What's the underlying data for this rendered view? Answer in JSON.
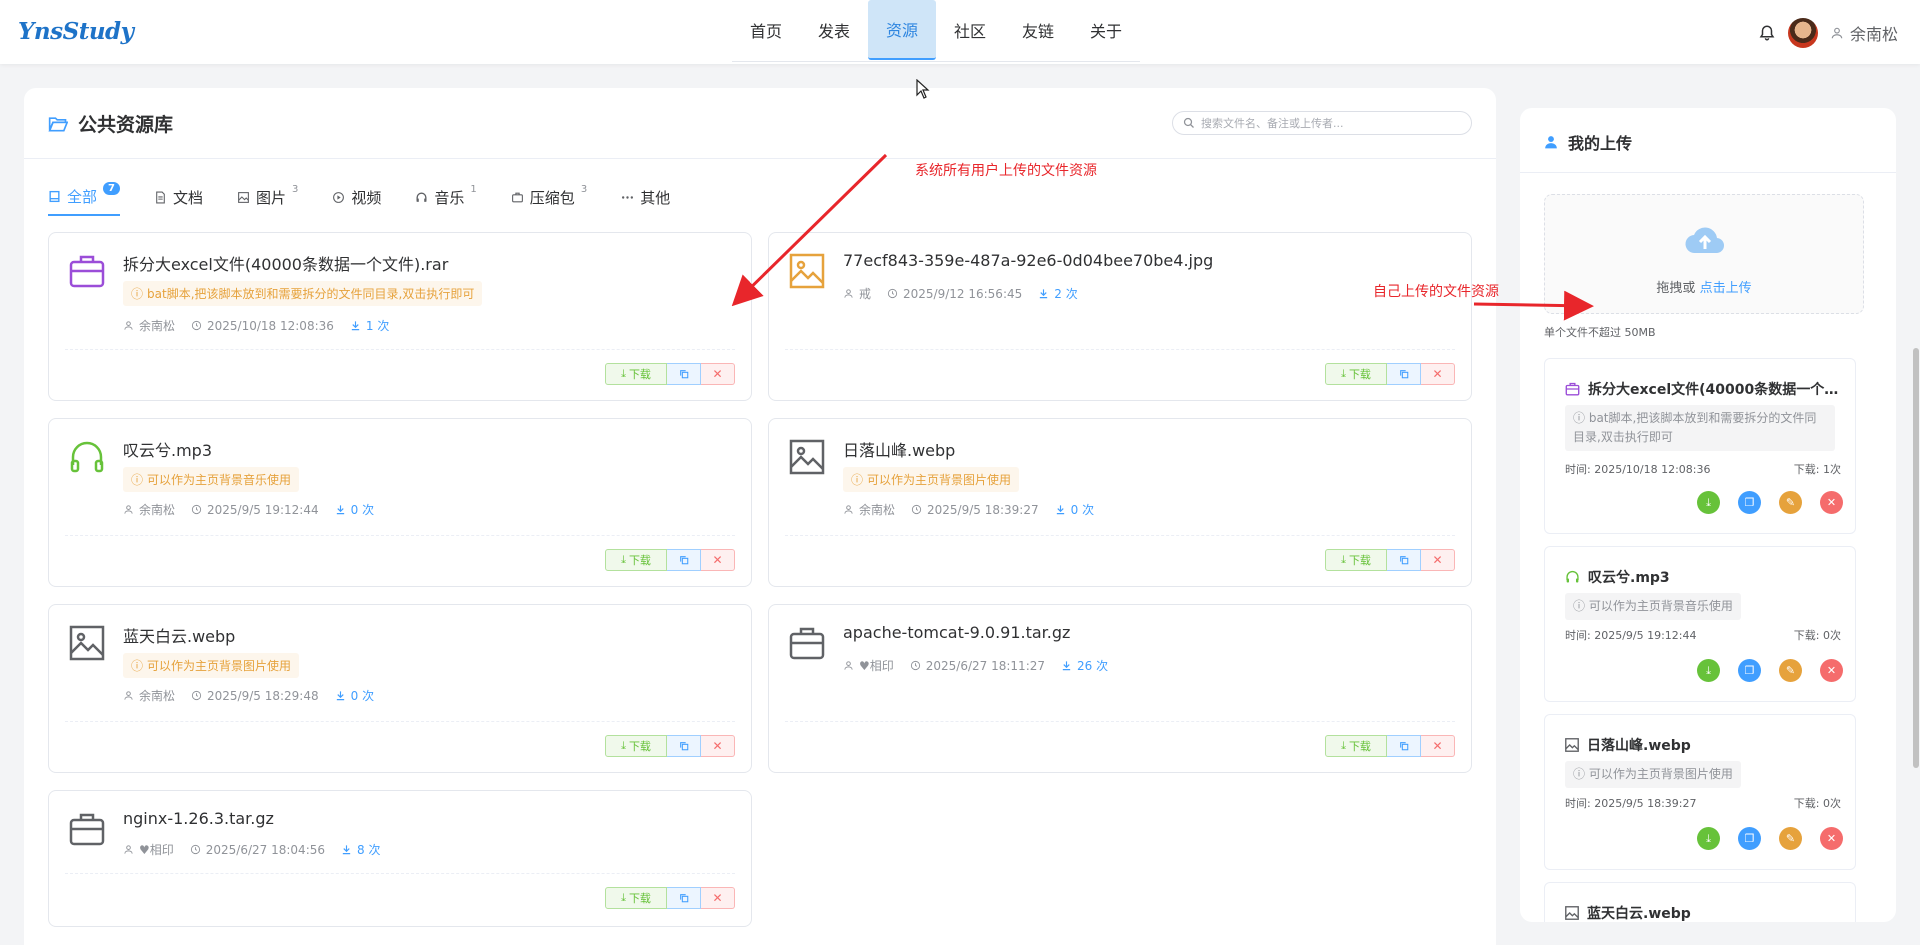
{
  "header": {
    "logo": "YnsStudy",
    "nav": [
      {
        "label": "首页",
        "active": false
      },
      {
        "label": "发表",
        "active": false
      },
      {
        "label": "资源",
        "active": true
      },
      {
        "label": "社区",
        "active": false
      },
      {
        "label": "友链",
        "active": false
      },
      {
        "label": "关于",
        "active": false
      }
    ],
    "user_name": "余南松"
  },
  "main": {
    "title": "公共资源库",
    "search_placeholder": "搜索文件名、备注或上传者...",
    "tabs": [
      {
        "label": "全部",
        "count": "7",
        "icon": "all-icon",
        "active": true
      },
      {
        "label": "文档",
        "count": "",
        "icon": "document-icon",
        "active": false
      },
      {
        "label": "图片",
        "count": "3",
        "icon": "image-icon",
        "active": false
      },
      {
        "label": "视频",
        "count": "",
        "icon": "video-icon",
        "active": false
      },
      {
        "label": "音乐",
        "count": "1",
        "icon": "music-icon",
        "active": false
      },
      {
        "label": "压缩包",
        "count": "3",
        "icon": "archive-icon",
        "active": false
      },
      {
        "label": "其他",
        "count": "",
        "icon": "more-icon",
        "active": false
      }
    ],
    "files": [
      {
        "name": "拆分大excel文件(40000条数据一个文件).rar",
        "note": "bat脚本,把该脚本放到和需要拆分的文件同目录,双击执行即可",
        "uploader": "余南松",
        "time": "2025/10/18 12:08:36",
        "downloads": "1 次",
        "icon": "briefcase-icon",
        "color": "#9b4dd8"
      },
      {
        "name": "77ecf843-359e-487a-92e6-0d04bee70be4.jpg",
        "note": "",
        "uploader": "戒",
        "time": "2025/9/12 16:56:45",
        "downloads": "2 次",
        "icon": "image-icon",
        "color": "#e6a23c"
      },
      {
        "name": "叹云兮.mp3",
        "note": "可以作为主页背景音乐使用",
        "uploader": "余南松",
        "time": "2025/9/5 19:12:44",
        "downloads": "0 次",
        "icon": "headphones-icon",
        "color": "#67c23a"
      },
      {
        "name": "日落山峰.webp",
        "note": "可以作为主页背景图片使用",
        "uploader": "余南松",
        "time": "2025/9/5 18:39:27",
        "downloads": "0 次",
        "icon": "image-icon",
        "color": "#606266"
      },
      {
        "name": "蓝天白云.webp",
        "note": "可以作为主页背景图片使用",
        "uploader": "余南松",
        "time": "2025/9/5 18:29:48",
        "downloads": "0 次",
        "icon": "image-icon",
        "color": "#606266"
      },
      {
        "name": "apache-tomcat-9.0.91.tar.gz",
        "note": "",
        "uploader": "♥相印",
        "time": "2025/6/27 18:11:27",
        "downloads": "26 次",
        "icon": "briefcase-icon",
        "color": "#606266"
      },
      {
        "name": "nginx-1.26.3.tar.gz",
        "note": "",
        "uploader": "♥相印",
        "time": "2025/6/27 18:04:56",
        "downloads": "8 次",
        "icon": "briefcase-icon",
        "color": "#606266"
      }
    ],
    "download_label": "下载"
  },
  "side": {
    "title": "我的上传",
    "upload_text": "拖拽或 ",
    "upload_link": "点击上传",
    "limit": "单个文件不超过 50MB",
    "items": [
      {
        "name": "拆分大excel文件(40000条数据一个…",
        "note": "bat脚本,把该脚本放到和需要拆分的文件同目录,双击执行即可",
        "time": "时间: 2025/10/18 12:08:36",
        "downloads": "下载: 1次",
        "icon": "briefcase-icon",
        "color": "#9b4dd8"
      },
      {
        "name": "叹云兮.mp3",
        "note": "可以作为主页背景音乐使用",
        "time": "时间: 2025/9/5 19:12:44",
        "downloads": "下载: 0次",
        "icon": "headphones-icon",
        "color": "#67c23a"
      },
      {
        "name": "日落山峰.webp",
        "note": "可以作为主页背景图片使用",
        "time": "时间: 2025/9/5 18:39:27",
        "downloads": "下载: 0次",
        "icon": "image-icon",
        "color": "#606266"
      },
      {
        "name": "蓝天白云.webp",
        "icon": "image-icon",
        "color": "#606266"
      }
    ]
  },
  "annotations": {
    "all_users": "系统所有用户上传的文件资源",
    "own_uploads": "自己上传的文件资源"
  },
  "colors": {
    "accent": "#409eff",
    "annotation": "#e8262b"
  }
}
